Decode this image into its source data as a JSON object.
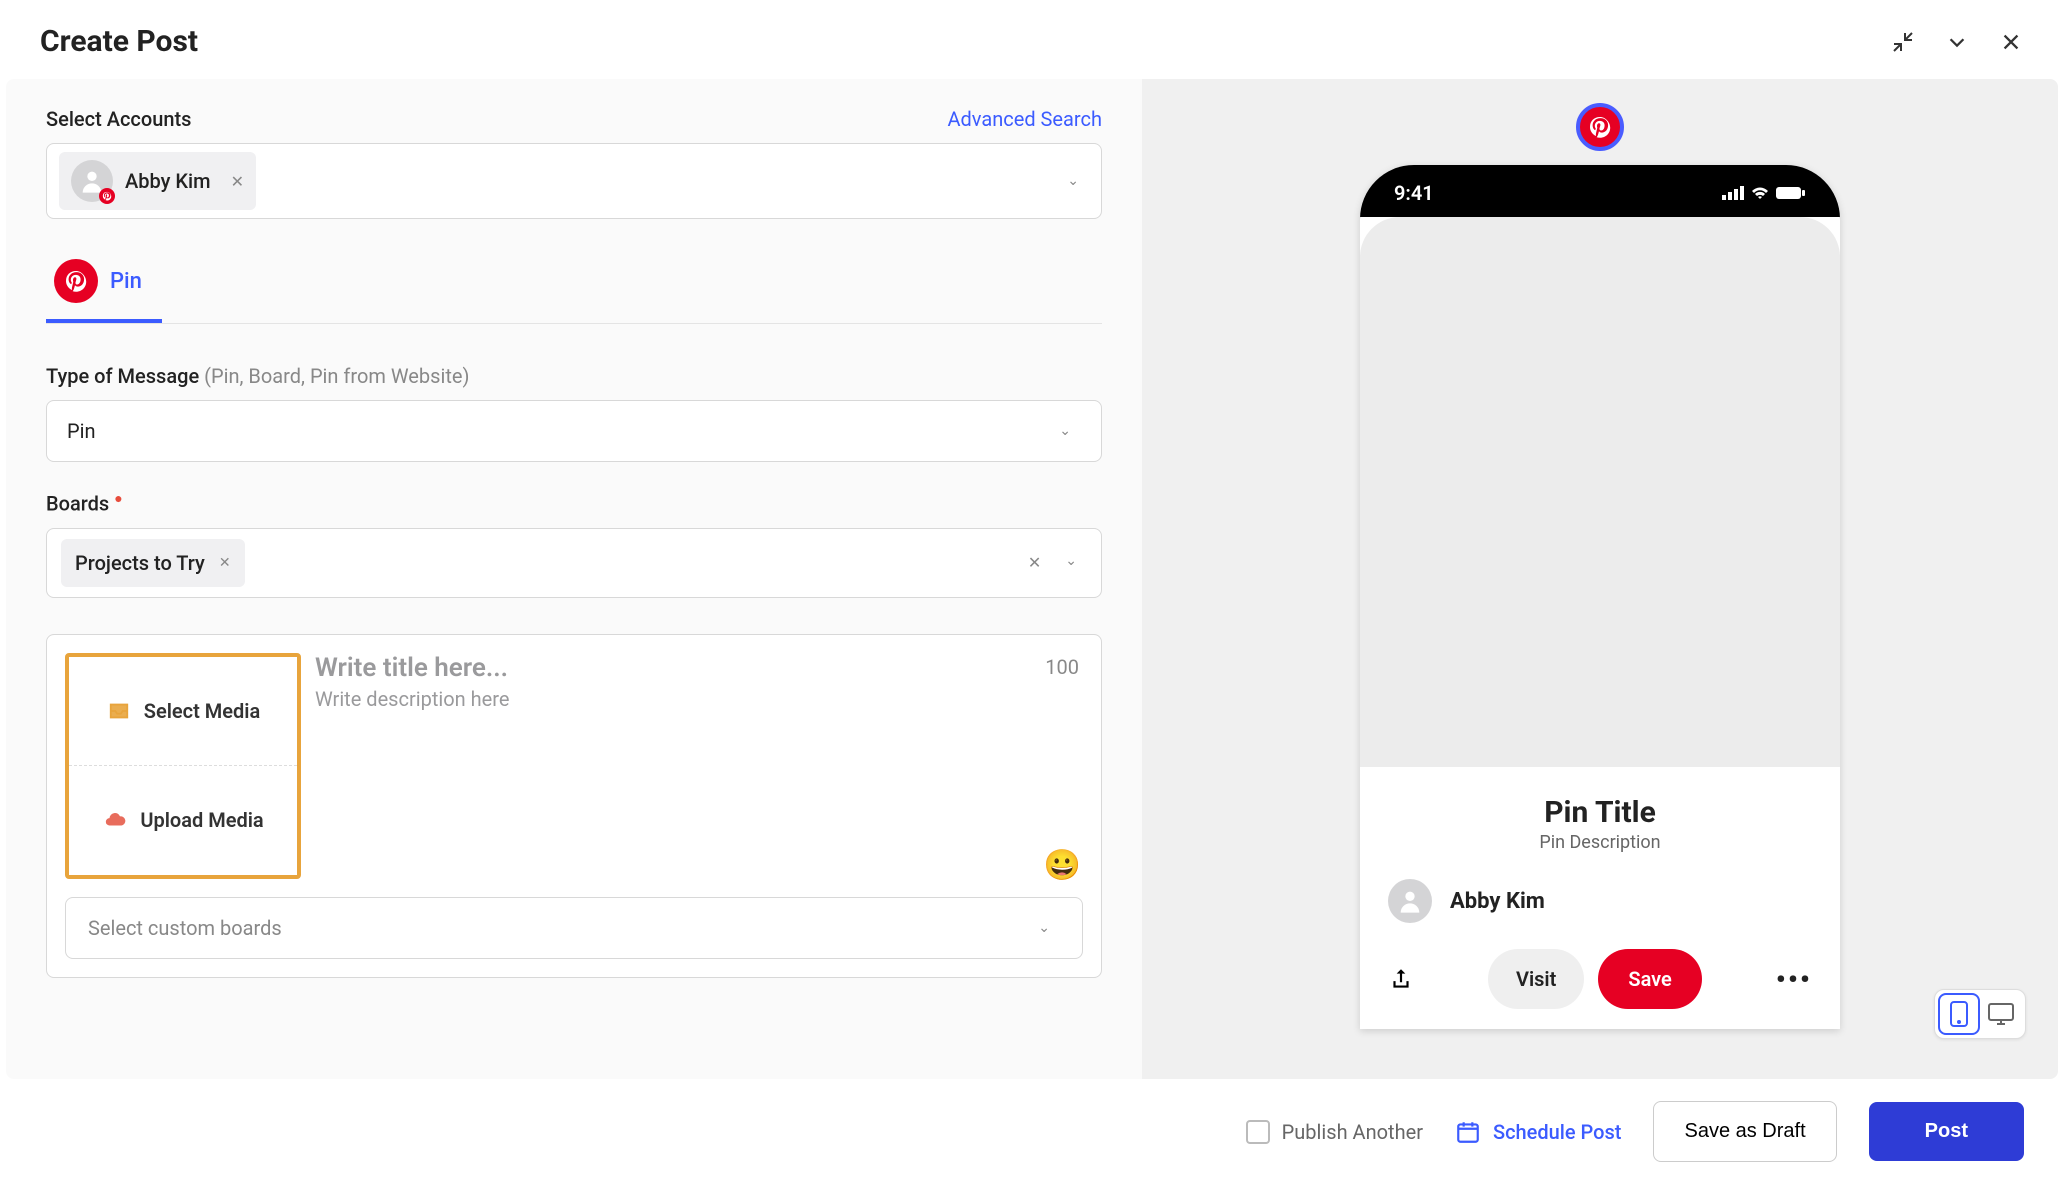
{
  "header": {
    "title": "Create Post"
  },
  "accounts": {
    "label": "Select Accounts",
    "advanced": "Advanced Search",
    "selected": [
      {
        "name": "Abby Kim"
      }
    ]
  },
  "tabs": [
    {
      "label": "Pin"
    }
  ],
  "messageType": {
    "label": "Type of Message",
    "hint": "(Pin, Board, Pin from Website)",
    "value": "Pin"
  },
  "boards": {
    "label": "Boards",
    "selected": [
      {
        "label": "Projects to Try"
      }
    ]
  },
  "composer": {
    "selectMedia": "Select Media",
    "uploadMedia": "Upload Media",
    "titlePlaceholder": "Write title here...",
    "descPlaceholder": "Write description here",
    "charLimit": "100",
    "customBoardsPlaceholder": "Select custom boards"
  },
  "preview": {
    "time": "9:41",
    "pinTitle": "Pin Title",
    "pinDesc": "Pin Description",
    "userName": "Abby Kim",
    "visit": "Visit",
    "save": "Save"
  },
  "footer": {
    "publishAnother": "Publish Another",
    "schedule": "Schedule Post",
    "draft": "Save as Draft",
    "post": "Post"
  }
}
